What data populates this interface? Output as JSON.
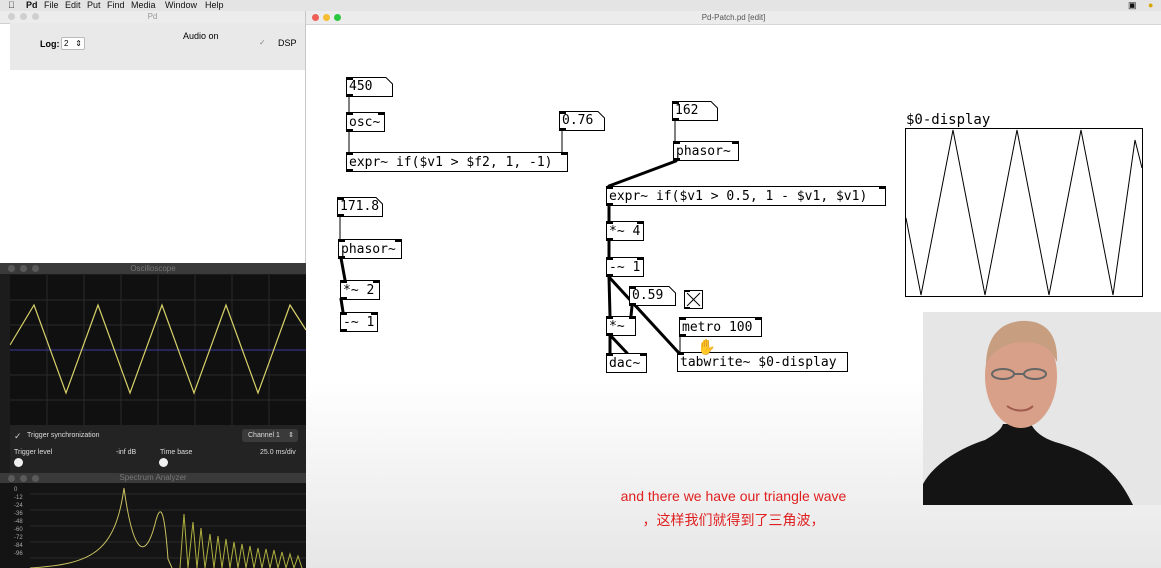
{
  "menubar": {
    "items": [
      "Pd",
      "File",
      "Edit",
      "Put",
      "Find",
      "Media",
      "Window",
      "Help"
    ]
  },
  "pd_window": {
    "title": "Pd",
    "log_label": "Log:",
    "log_value": "2",
    "audio_status": "Audio on",
    "dsp_label": "DSP",
    "dsp_checked": true
  },
  "oscilloscope": {
    "title": "Oscilloscope",
    "trigger_sync_label": "Trigger synchronization",
    "channel_value": "Channel 1",
    "trigger_level_label": "Trigger level",
    "trigger_level_value": "-inf dB",
    "time_base_label": "Time base",
    "time_base_value": "25.0 ms/div"
  },
  "spectrum": {
    "title": "Spectrum Analyzer",
    "db_ticks": [
      "0",
      "-12",
      "-24",
      "-36",
      "-48",
      "-60",
      "-72",
      "-84",
      "-96"
    ]
  },
  "patch": {
    "title": "Pd-Patch.pd [edit]",
    "numbers": {
      "n450": "450",
      "n076": "0.76",
      "n162": "162",
      "n1718": "171.8",
      "n059": "0.59"
    },
    "objects": {
      "osc": "osc~",
      "expr1": "expr~ if($v1 > $f2, 1, -1)",
      "phasor1": "phasor~",
      "expr2": "expr~ if($v1 > 0.5, 1 - $v1, $v1)",
      "mul4": "*~ 4",
      "sub1a": "-~ 1",
      "phasor2": "phasor~",
      "mul2": "*~ 2",
      "sub1b": "-~ 1",
      "mul": "*~",
      "dac": "dac~",
      "metro": "metro 100",
      "tabwrite": "tabwrite~ $0-display"
    },
    "array_label": "$0-display"
  },
  "subtitles": {
    "english": "and there we have our triangle wave",
    "chinese": "，这样我们就得到了三角波，"
  },
  "colors": {
    "waveform": "#d8d26a",
    "scope_axis": "#3a3aa0",
    "subtitle": "#e02020"
  }
}
